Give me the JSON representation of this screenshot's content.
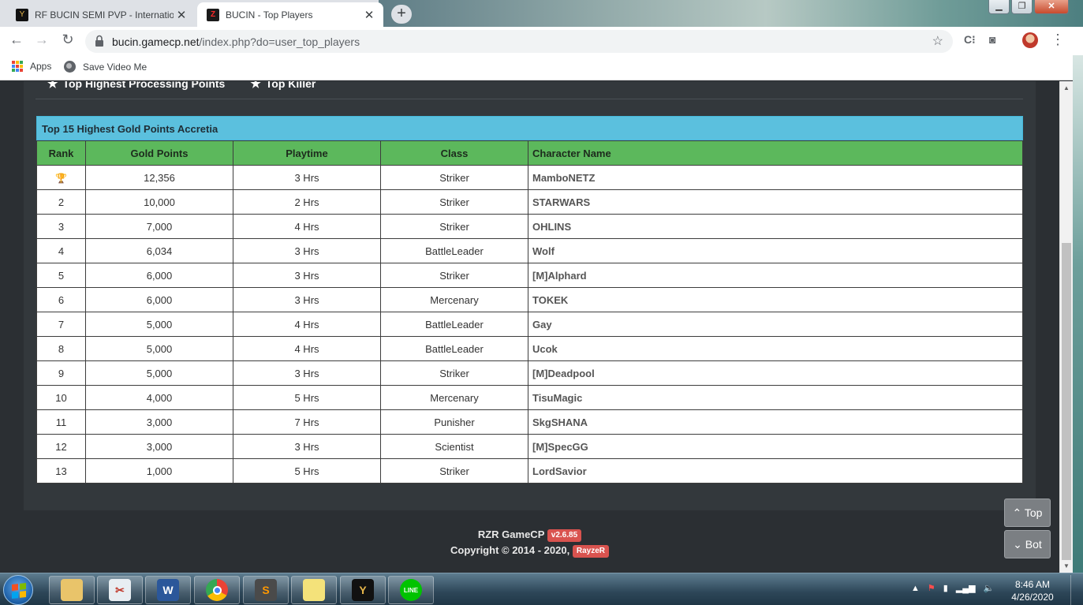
{
  "browser": {
    "tabs": [
      {
        "title": "RF BUCIN SEMI PVP - International",
        "active": false
      },
      {
        "title": "BUCIN - Top Players",
        "active": true
      }
    ],
    "new_tab": "+",
    "close": "✕",
    "url_host": "bucin.gamecp.net",
    "url_path": "/index.php?do=user_top_players",
    "bookmarks": [
      {
        "label": "Apps",
        "icon": "apps-grid-icon"
      },
      {
        "label": "Save Video Me",
        "icon": "globe-icon"
      }
    ],
    "window_buttons": [
      "minimize",
      "maximize",
      "close"
    ]
  },
  "page": {
    "nav_tabs": [
      {
        "label": "Top Highest Processing Points",
        "icon": "star-icon"
      },
      {
        "label": "Top Killer",
        "icon": "star-icon"
      }
    ],
    "table_title": "Top 15 Highest Gold Points Accretia",
    "columns": [
      "Rank",
      "Gold Points",
      "Playtime",
      "Class",
      "Character Name"
    ],
    "rows": [
      {
        "rank": "",
        "rank_icon": "trophy-icon",
        "gold": "12,356",
        "playtime": "3 Hrs",
        "class": "Striker",
        "name": "MamboNETZ"
      },
      {
        "rank": "2",
        "gold": "10,000",
        "playtime": "2 Hrs",
        "class": "Striker",
        "name": "STARWARS"
      },
      {
        "rank": "3",
        "gold": "7,000",
        "playtime": "4 Hrs",
        "class": "Striker",
        "name": "OHLINS"
      },
      {
        "rank": "4",
        "gold": "6,034",
        "playtime": "3 Hrs",
        "class": "BattleLeader",
        "name": "Wolf"
      },
      {
        "rank": "5",
        "gold": "6,000",
        "playtime": "3 Hrs",
        "class": "Striker",
        "name": "[M]Alphard"
      },
      {
        "rank": "6",
        "gold": "6,000",
        "playtime": "3 Hrs",
        "class": "Mercenary",
        "name": "TOKEK"
      },
      {
        "rank": "7",
        "gold": "5,000",
        "playtime": "4 Hrs",
        "class": "BattleLeader",
        "name": "Gay"
      },
      {
        "rank": "8",
        "gold": "5,000",
        "playtime": "4 Hrs",
        "class": "BattleLeader",
        "name": "Ucok"
      },
      {
        "rank": "9",
        "gold": "5,000",
        "playtime": "3 Hrs",
        "class": "Striker",
        "name": "[M]Deadpool"
      },
      {
        "rank": "10",
        "gold": "4,000",
        "playtime": "5 Hrs",
        "class": "Mercenary",
        "name": "TisuMagic"
      },
      {
        "rank": "11",
        "gold": "3,000",
        "playtime": "7 Hrs",
        "class": "Punisher",
        "name": "SkgSHANA"
      },
      {
        "rank": "12",
        "gold": "3,000",
        "playtime": "3 Hrs",
        "class": "Scientist",
        "name": "[M]SpecGG"
      },
      {
        "rank": "13",
        "gold": "1,000",
        "playtime": "5 Hrs",
        "class": "Striker",
        "name": "LordSavior"
      }
    ],
    "footer": {
      "brand": "RZR GameCP",
      "version": "v2.6.85",
      "copyright": "Copyright © 2014 - 2020,",
      "author": "RayzeR"
    },
    "float_buttons": {
      "top": "Top",
      "bottom": "Bot"
    }
  },
  "taskbar": {
    "apps": [
      "explorer",
      "snipping-tool",
      "word",
      "chrome",
      "sublime-text",
      "sticky-notes",
      "rf-online",
      "line"
    ],
    "clock_time": "8:46 AM",
    "clock_date": "4/26/2020"
  },
  "colors": {
    "page_bg": "#2b2f33",
    "panel_bg": "#33383c",
    "title_bar": "#5bc0de",
    "header_row": "#5cb85c",
    "badge": "#d9534f"
  }
}
